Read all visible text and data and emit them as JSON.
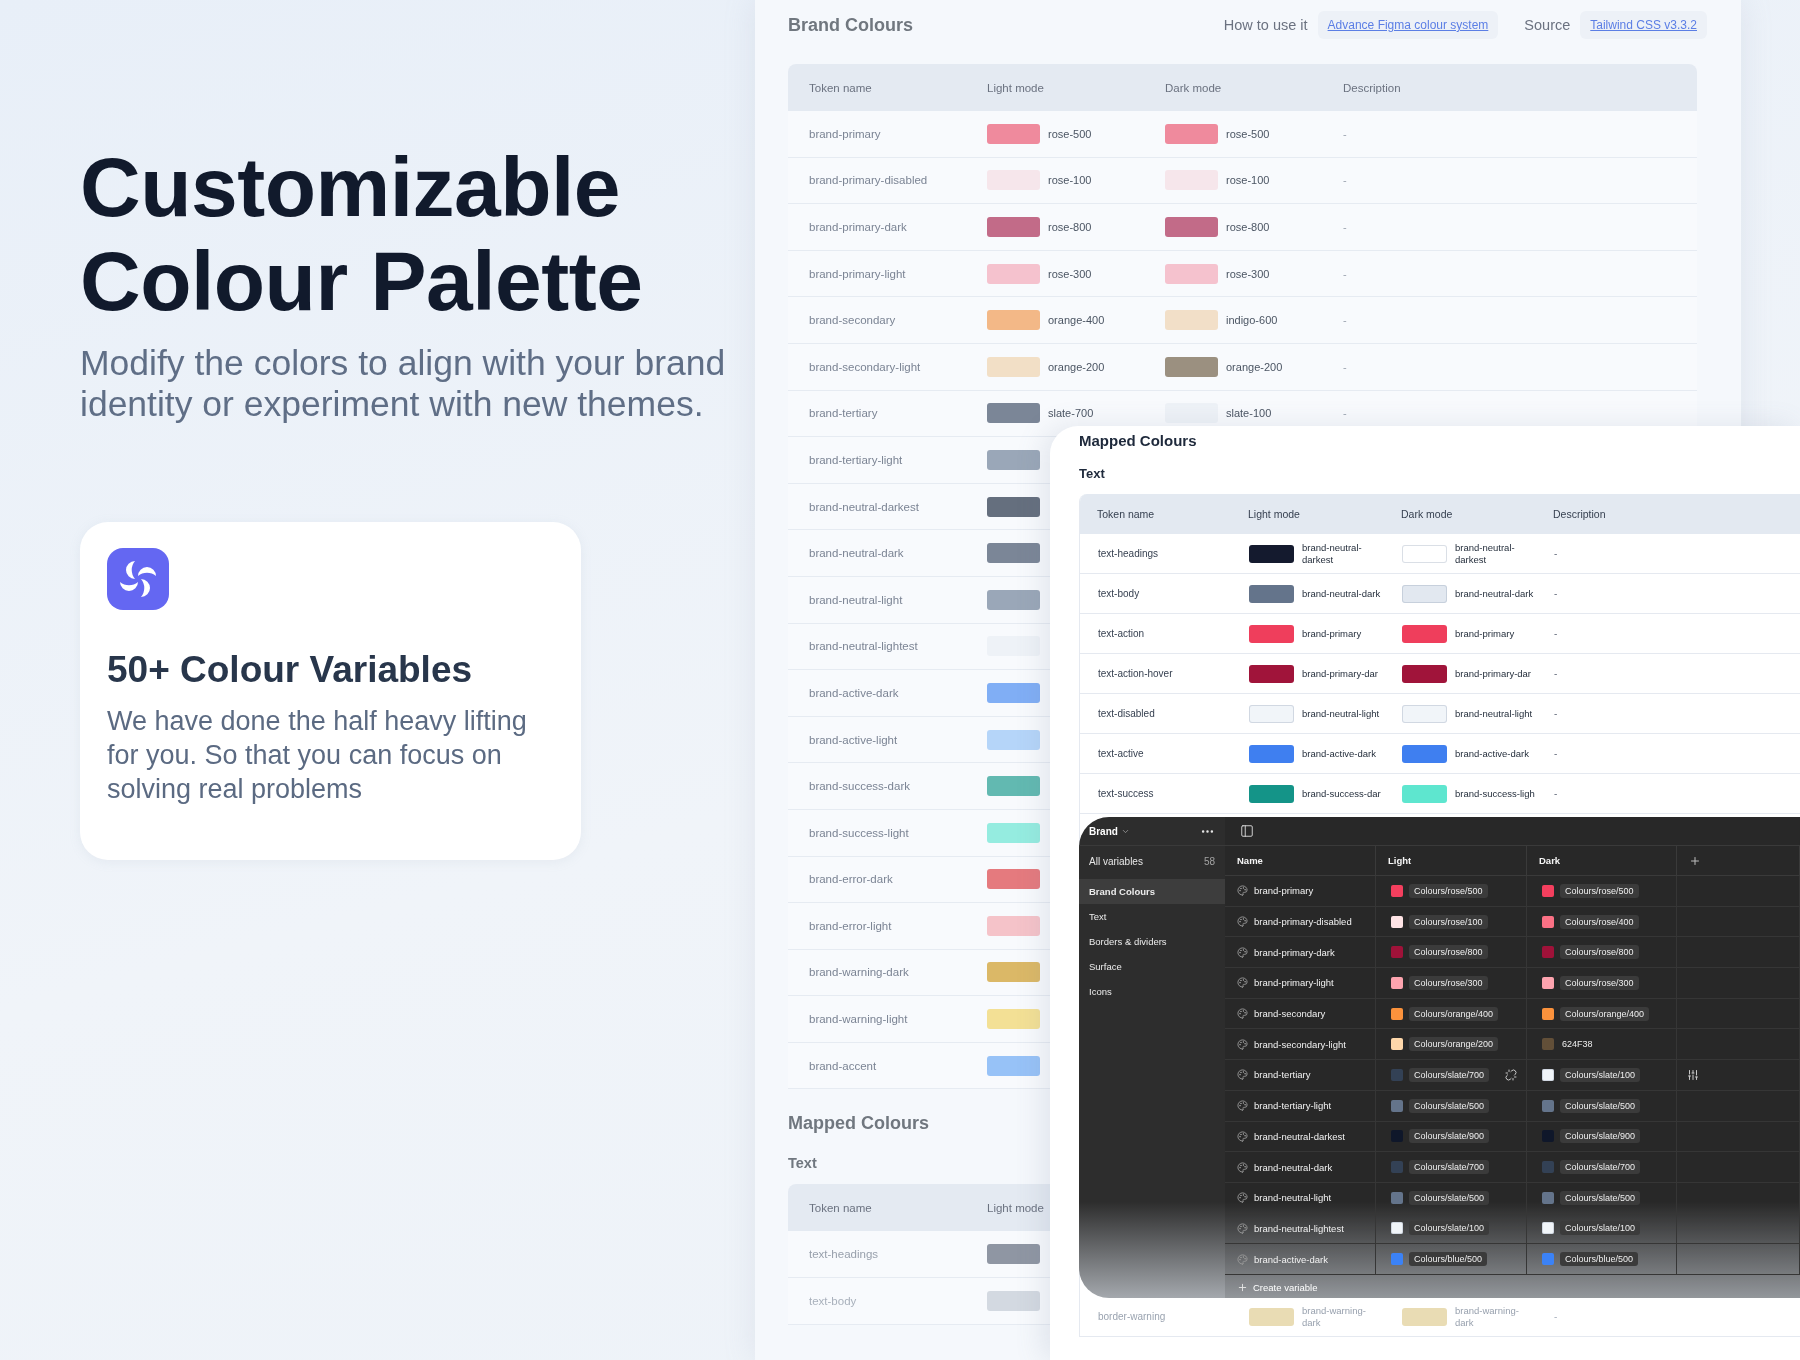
{
  "hero": {
    "headline": "Customizable Colour Palette",
    "subtitle": "Modify the colors to align with your brand identity or experiment with new themes."
  },
  "feature_card": {
    "title": "50+ Colour Variables",
    "body": "We have done the half heavy lifting for you. So that you can focus on solving real problems"
  },
  "brand_colours_panel": {
    "title": "Brand Colours",
    "links": [
      {
        "label": "How to use it",
        "link_text": "Advance Figma colour system"
      },
      {
        "label": "Source",
        "link_text": "Tailwind CSS v3.3.2"
      }
    ],
    "table": {
      "columns": [
        "Token name",
        "Light mode",
        "Dark mode",
        "Description"
      ],
      "rows": [
        {
          "token": "brand-primary",
          "light": {
            "color": "#ef8a9d",
            "value": "rose-500"
          },
          "dark": {
            "color": "#ef8a9d",
            "value": "rose-500"
          },
          "description": "-"
        },
        {
          "token": "brand-primary-disabled",
          "light": {
            "color": "#f6e6eb",
            "value": "rose-100"
          },
          "dark": {
            "color": "#f6e6eb",
            "value": "rose-100"
          },
          "description": "-"
        },
        {
          "token": "brand-primary-dark",
          "light": {
            "color": "#c26b88",
            "value": "rose-800"
          },
          "dark": {
            "color": "#c26b88",
            "value": "rose-800"
          },
          "description": "-"
        },
        {
          "token": "brand-primary-light",
          "light": {
            "color": "#f5c2ce",
            "value": "rose-300"
          },
          "dark": {
            "color": "#f5c2ce",
            "value": "rose-300"
          },
          "description": "-"
        },
        {
          "token": "brand-secondary",
          "light": {
            "color": "#f3b887",
            "value": "orange-400"
          },
          "dark": {
            "color": "#f2dfc8",
            "value": "indigo-600"
          },
          "description": "-"
        },
        {
          "token": "brand-secondary-light",
          "light": {
            "color": "#f2dfc6",
            "value": "orange-200"
          },
          "dark": {
            "color": "#9b9080",
            "value": "orange-200"
          },
          "description": "-"
        },
        {
          "token": "brand-tertiary",
          "light": {
            "color": "#7b8697",
            "value": "slate-700"
          },
          "dark": {
            "color": "#eef2f7",
            "value": "slate-100"
          },
          "description": "-"
        },
        {
          "token": "brand-tertiary-light",
          "light": {
            "color": "#9aa7b8"
          }
        },
        {
          "token": "brand-neutral-darkest",
          "light": {
            "color": "#656f7e"
          }
        },
        {
          "token": "brand-neutral-dark",
          "light": {
            "color": "#7b8697"
          }
        },
        {
          "token": "brand-neutral-light",
          "light": {
            "color": "#9aa7b8"
          }
        },
        {
          "token": "brand-neutral-lightest",
          "light": {
            "color": "#eef2f7"
          }
        },
        {
          "token": "brand-active-dark",
          "light": {
            "color": "#80aef5"
          }
        },
        {
          "token": "brand-active-light",
          "light": {
            "color": "#b5d5f9"
          }
        },
        {
          "token": "brand-success-dark",
          "light": {
            "color": "#62b9b1"
          }
        },
        {
          "token": "brand-success-light",
          "light": {
            "color": "#95ece0"
          }
        },
        {
          "token": "brand-error-dark",
          "light": {
            "color": "#e57a7e"
          }
        },
        {
          "token": "brand-error-light",
          "light": {
            "color": "#f5c3c9"
          }
        },
        {
          "token": "brand-warning-dark",
          "light": {
            "color": "#dbb867"
          }
        },
        {
          "token": "brand-warning-light",
          "light": {
            "color": "#f3e095"
          }
        },
        {
          "token": "brand-accent",
          "light": {
            "color": "#97c2f7"
          }
        }
      ]
    },
    "mapped_section": {
      "title": "Mapped Colours",
      "group": "Text",
      "columns": [
        "Token name",
        "Light mode"
      ],
      "rows": [
        {
          "token": "text-headings",
          "light": {
            "color": "#8f96a3"
          }
        },
        {
          "token": "text-body",
          "light": {
            "color": "#d3d9e1"
          }
        }
      ]
    }
  },
  "mapped_colours_panel": {
    "title": "Mapped Colours",
    "group": "Text",
    "columns": [
      "Token name",
      "Light mode",
      "Dark mode",
      "Description"
    ],
    "rows": [
      {
        "token": "text-headings",
        "light": {
          "color": "#141a2e",
          "value": "brand-neutral-darkest"
        },
        "dark": {
          "color": "#ffffff",
          "value": "brand-neutral-darkest"
        },
        "description": "-"
      },
      {
        "token": "text-body",
        "light": {
          "color": "#64748b",
          "value": "brand-neutral-dark"
        },
        "dark": {
          "color": "#e2e8f0",
          "value": "brand-neutral-dark"
        },
        "description": "-"
      },
      {
        "token": "text-action",
        "light": {
          "color": "#ef3e5c",
          "value": "brand-primary"
        },
        "dark": {
          "color": "#ef3e5c",
          "value": "brand-primary"
        },
        "description": "-"
      },
      {
        "token": "text-action-hover",
        "light": {
          "color": "#a0143a",
          "value": "brand-primary-dar"
        },
        "dark": {
          "color": "#a0143a",
          "value": "brand-primary-dar"
        },
        "description": "-"
      },
      {
        "token": "text-disabled",
        "light": {
          "color": "#f1f5f9",
          "value": "brand-neutral-light"
        },
        "dark": {
          "color": "#f1f5f9",
          "value": "brand-neutral-light"
        },
        "description": "-"
      },
      {
        "token": "text-active",
        "light": {
          "color": "#3f7ff0",
          "value": "brand-active-dark"
        },
        "dark": {
          "color": "#3f7ff0",
          "value": "brand-active-dark"
        },
        "description": "-"
      },
      {
        "token": "text-success",
        "light": {
          "color": "#149488",
          "value": "brand-success-dar"
        },
        "dark": {
          "color": "#5ee6cf",
          "value": "brand-success-ligh"
        },
        "description": "-"
      }
    ],
    "rows_below": [
      {
        "token": "border-warning",
        "light": {
          "color": "#e9dcb4",
          "value": "brand-warning-dark"
        },
        "dark": {
          "color": "#e9dcb4",
          "value": "brand-warning-dark"
        },
        "description": "-"
      }
    ]
  },
  "variables_panel": {
    "collection": "Brand",
    "all_variables": {
      "label": "All variables",
      "count": "58"
    },
    "groups": [
      {
        "label": "Brand Colours",
        "selected": true
      },
      {
        "label": "Text",
        "selected": false
      },
      {
        "label": "Borders & dividers",
        "selected": false
      },
      {
        "label": "Surface",
        "selected": false
      },
      {
        "label": "Icons",
        "selected": false
      }
    ],
    "columns": [
      "Name",
      "Light",
      "Dark"
    ],
    "rows": [
      {
        "name": "brand-primary",
        "hovered": false,
        "light": {
          "kind": "alias",
          "color": "#f43f5e",
          "value": "Colours/rose/500"
        },
        "dark": {
          "kind": "alias",
          "color": "#f43f5e",
          "value": "Colours/rose/500"
        }
      },
      {
        "name": "brand-primary-disabled",
        "hovered": false,
        "light": {
          "kind": "alias",
          "color": "#ffe4e6",
          "value": "Colours/rose/100"
        },
        "dark": {
          "kind": "alias",
          "color": "#fb7185",
          "value": "Colours/rose/400"
        }
      },
      {
        "name": "brand-primary-dark",
        "hovered": false,
        "light": {
          "kind": "alias",
          "color": "#9f1239",
          "value": "Colours/rose/800"
        },
        "dark": {
          "kind": "alias",
          "color": "#9f1239",
          "value": "Colours/rose/800"
        }
      },
      {
        "name": "brand-primary-light",
        "hovered": false,
        "light": {
          "kind": "alias",
          "color": "#fda4af",
          "value": "Colours/rose/300"
        },
        "dark": {
          "kind": "alias",
          "color": "#fda4af",
          "value": "Colours/rose/300"
        }
      },
      {
        "name": "brand-secondary",
        "hovered": false,
        "light": {
          "kind": "alias",
          "color": "#fb923c",
          "value": "Colours/orange/400"
        },
        "dark": {
          "kind": "alias",
          "color": "#fb923c",
          "value": "Colours/orange/400"
        }
      },
      {
        "name": "brand-secondary-light",
        "hovered": false,
        "light": {
          "kind": "alias",
          "color": "#fed7aa",
          "value": "Colours/orange/200"
        },
        "dark": {
          "kind": "hex",
          "color": "#624f38",
          "value": "624F38"
        }
      },
      {
        "name": "brand-tertiary",
        "hovered": true,
        "light": {
          "kind": "alias",
          "color": "#334155",
          "value": "Colours/slate/700"
        },
        "dark": {
          "kind": "alias",
          "color": "#f1f5f9",
          "value": "Colours/slate/100"
        }
      },
      {
        "name": "brand-tertiary-light",
        "hovered": false,
        "light": {
          "kind": "alias",
          "color": "#64748b",
          "value": "Colours/slate/500"
        },
        "dark": {
          "kind": "alias",
          "color": "#64748b",
          "value": "Colours/slate/500"
        }
      },
      {
        "name": "brand-neutral-darkest",
        "hovered": false,
        "light": {
          "kind": "alias",
          "color": "#0f172a",
          "value": "Colours/slate/900"
        },
        "dark": {
          "kind": "alias",
          "color": "#0f172a",
          "value": "Colours/slate/900"
        }
      },
      {
        "name": "brand-neutral-dark",
        "hovered": false,
        "light": {
          "kind": "alias",
          "color": "#334155",
          "value": "Colours/slate/700"
        },
        "dark": {
          "kind": "alias",
          "color": "#334155",
          "value": "Colours/slate/700"
        }
      },
      {
        "name": "brand-neutral-light",
        "hovered": false,
        "light": {
          "kind": "alias",
          "color": "#64748b",
          "value": "Colours/slate/500"
        },
        "dark": {
          "kind": "alias",
          "color": "#64748b",
          "value": "Colours/slate/500"
        }
      },
      {
        "name": "brand-neutral-lightest",
        "hovered": false,
        "light": {
          "kind": "alias",
          "color": "#f1f5f9",
          "value": "Colours/slate/100"
        },
        "dark": {
          "kind": "alias",
          "color": "#f1f5f9",
          "value": "Colours/slate/100"
        }
      },
      {
        "name": "brand-active-dark",
        "hovered": false,
        "light": {
          "kind": "alias",
          "color": "#3b82f6",
          "value": "Colours/blue/500"
        },
        "dark": {
          "kind": "alias",
          "color": "#3b82f6",
          "value": "Colours/blue/500"
        }
      }
    ],
    "create_label": "Create variable"
  }
}
